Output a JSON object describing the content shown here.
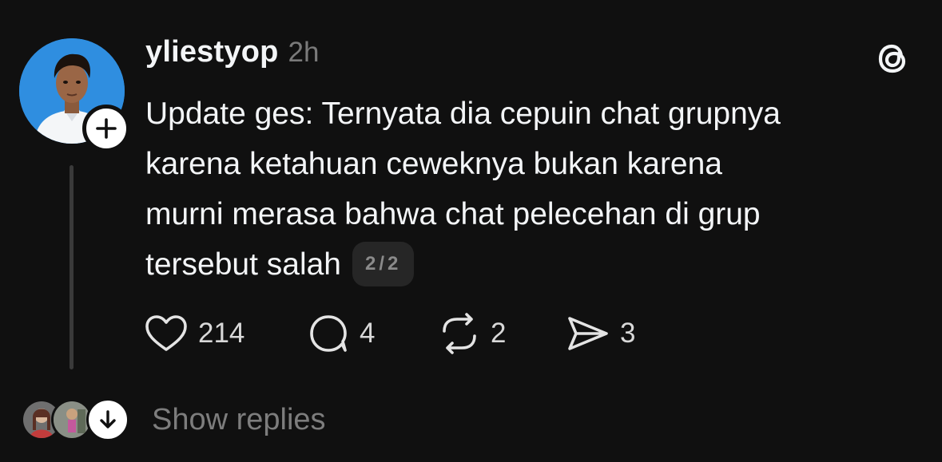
{
  "post": {
    "username": "yliestyop",
    "timestamp": "2h",
    "text_lines": [
      "Update ges: Ternyata dia cepuin chat grupnya",
      "karena ketahuan ceweknya bukan karena",
      "murni merasa bahwa chat pelecehan di grup",
      "tersebut salah"
    ],
    "page_indicator": "2/2",
    "likes": "214",
    "replies": "4",
    "reposts": "2",
    "shares": "3"
  },
  "replies_section": {
    "label": "Show replies"
  },
  "icons": {
    "follow": "plus-icon",
    "brand": "threads-logo-icon",
    "like": "heart-icon",
    "reply": "comment-icon",
    "repost": "repost-icon",
    "share": "send-icon",
    "expand": "arrow-down-icon"
  },
  "colors": {
    "background": "#101010",
    "text": "#f3f5f7",
    "muted": "#7a7a7a",
    "badge_bg": "#262626"
  }
}
